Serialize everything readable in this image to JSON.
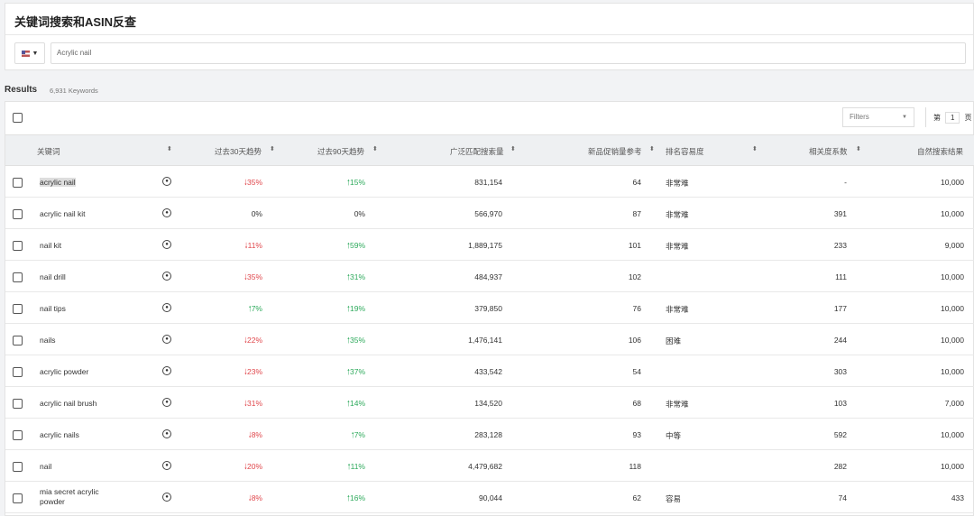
{
  "header": {
    "title": "关键词搜索和ASIN反查",
    "search_value": "Acrylic nail",
    "country": "US"
  },
  "results": {
    "label": "Results",
    "count": "6,931 Keywords"
  },
  "toolbar": {
    "filters": "Filters",
    "page_prefix": "第",
    "page": "1",
    "page_suffix": "页"
  },
  "columns": [
    "关键词",
    "过去30天趋势",
    "过去90天趋势",
    "广泛匹配搜索量",
    "新品促销量参考",
    "排名容易度",
    "相关度系数",
    "自然搜索结果"
  ],
  "rows": [
    {
      "kw": "acrylic nail",
      "t30": "35%",
      "d30": "down",
      "t90": "15%",
      "d90": "up",
      "vol": "831,154",
      "promo": "64",
      "ease": "非常难",
      "rel": "-",
      "nat": "10,000"
    },
    {
      "kw": "acrylic nail kit",
      "t30": "0%",
      "d30": "flat",
      "t90": "0%",
      "d90": "flat",
      "vol": "566,970",
      "promo": "87",
      "ease": "非常难",
      "rel": "391",
      "nat": "10,000"
    },
    {
      "kw": "nail kit",
      "t30": "11%",
      "d30": "down",
      "t90": "59%",
      "d90": "up",
      "vol": "1,889,175",
      "promo": "101",
      "ease": "非常难",
      "rel": "233",
      "nat": "9,000"
    },
    {
      "kw": "nail drill",
      "t30": "35%",
      "d30": "down",
      "t90": "31%",
      "d90": "up",
      "vol": "484,937",
      "promo": "102",
      "ease": "",
      "rel": "111",
      "nat": "10,000"
    },
    {
      "kw": "nail tips",
      "t30": "7%",
      "d30": "up",
      "t90": "19%",
      "d90": "up",
      "vol": "379,850",
      "promo": "76",
      "ease": "非常难",
      "rel": "177",
      "nat": "10,000"
    },
    {
      "kw": "nails",
      "t30": "22%",
      "d30": "down",
      "t90": "35%",
      "d90": "up",
      "vol": "1,476,141",
      "promo": "106",
      "ease": "困难",
      "rel": "244",
      "nat": "10,000"
    },
    {
      "kw": "acrylic powder",
      "t30": "23%",
      "d30": "down",
      "t90": "37%",
      "d90": "up",
      "vol": "433,542",
      "promo": "54",
      "ease": "",
      "rel": "303",
      "nat": "10,000"
    },
    {
      "kw": "acrylic nail brush",
      "t30": "31%",
      "d30": "down",
      "t90": "14%",
      "d90": "up",
      "vol": "134,520",
      "promo": "68",
      "ease": "非常难",
      "rel": "103",
      "nat": "7,000"
    },
    {
      "kw": "acrylic nails",
      "t30": "8%",
      "d30": "down",
      "t90": "7%",
      "d90": "up",
      "vol": "283,128",
      "promo": "93",
      "ease": "中等",
      "rel": "592",
      "nat": "10,000"
    },
    {
      "kw": "nail",
      "t30": "20%",
      "d30": "down",
      "t90": "11%",
      "d90": "up",
      "vol": "4,479,682",
      "promo": "118",
      "ease": "",
      "rel": "282",
      "nat": "10,000"
    },
    {
      "kw": "mia secret acrylic powder",
      "t30": "8%",
      "d30": "down",
      "t90": "16%",
      "d90": "up",
      "vol": "90,044",
      "promo": "62",
      "ease": "容易",
      "rel": "74",
      "nat": "433"
    }
  ]
}
